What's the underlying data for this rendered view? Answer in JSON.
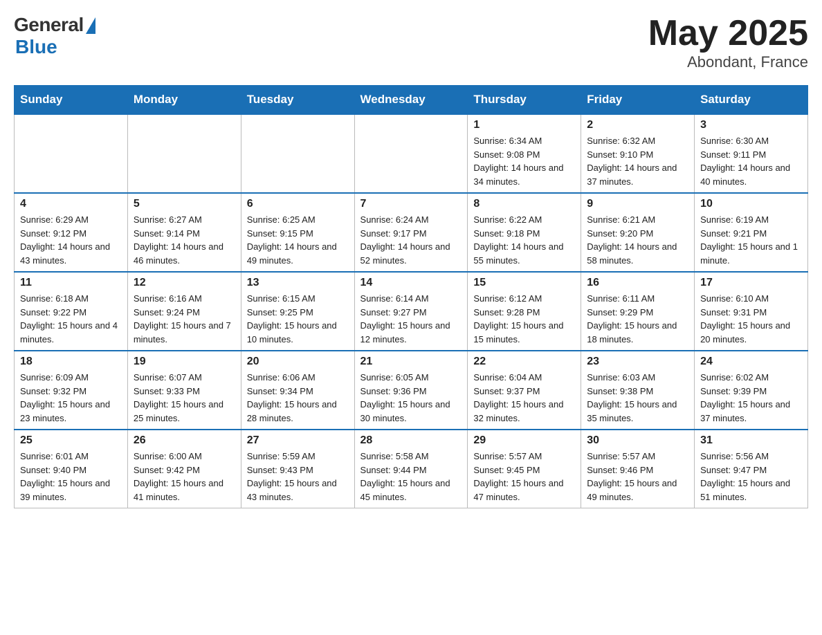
{
  "header": {
    "logo_general": "General",
    "logo_blue": "Blue",
    "month_title": "May 2025",
    "location": "Abondant, France"
  },
  "weekdays": [
    "Sunday",
    "Monday",
    "Tuesday",
    "Wednesday",
    "Thursday",
    "Friday",
    "Saturday"
  ],
  "weeks": [
    [
      {
        "day": "",
        "info": ""
      },
      {
        "day": "",
        "info": ""
      },
      {
        "day": "",
        "info": ""
      },
      {
        "day": "",
        "info": ""
      },
      {
        "day": "1",
        "info": "Sunrise: 6:34 AM\nSunset: 9:08 PM\nDaylight: 14 hours and 34 minutes."
      },
      {
        "day": "2",
        "info": "Sunrise: 6:32 AM\nSunset: 9:10 PM\nDaylight: 14 hours and 37 minutes."
      },
      {
        "day": "3",
        "info": "Sunrise: 6:30 AM\nSunset: 9:11 PM\nDaylight: 14 hours and 40 minutes."
      }
    ],
    [
      {
        "day": "4",
        "info": "Sunrise: 6:29 AM\nSunset: 9:12 PM\nDaylight: 14 hours and 43 minutes."
      },
      {
        "day": "5",
        "info": "Sunrise: 6:27 AM\nSunset: 9:14 PM\nDaylight: 14 hours and 46 minutes."
      },
      {
        "day": "6",
        "info": "Sunrise: 6:25 AM\nSunset: 9:15 PM\nDaylight: 14 hours and 49 minutes."
      },
      {
        "day": "7",
        "info": "Sunrise: 6:24 AM\nSunset: 9:17 PM\nDaylight: 14 hours and 52 minutes."
      },
      {
        "day": "8",
        "info": "Sunrise: 6:22 AM\nSunset: 9:18 PM\nDaylight: 14 hours and 55 minutes."
      },
      {
        "day": "9",
        "info": "Sunrise: 6:21 AM\nSunset: 9:20 PM\nDaylight: 14 hours and 58 minutes."
      },
      {
        "day": "10",
        "info": "Sunrise: 6:19 AM\nSunset: 9:21 PM\nDaylight: 15 hours and 1 minute."
      }
    ],
    [
      {
        "day": "11",
        "info": "Sunrise: 6:18 AM\nSunset: 9:22 PM\nDaylight: 15 hours and 4 minutes."
      },
      {
        "day": "12",
        "info": "Sunrise: 6:16 AM\nSunset: 9:24 PM\nDaylight: 15 hours and 7 minutes."
      },
      {
        "day": "13",
        "info": "Sunrise: 6:15 AM\nSunset: 9:25 PM\nDaylight: 15 hours and 10 minutes."
      },
      {
        "day": "14",
        "info": "Sunrise: 6:14 AM\nSunset: 9:27 PM\nDaylight: 15 hours and 12 minutes."
      },
      {
        "day": "15",
        "info": "Sunrise: 6:12 AM\nSunset: 9:28 PM\nDaylight: 15 hours and 15 minutes."
      },
      {
        "day": "16",
        "info": "Sunrise: 6:11 AM\nSunset: 9:29 PM\nDaylight: 15 hours and 18 minutes."
      },
      {
        "day": "17",
        "info": "Sunrise: 6:10 AM\nSunset: 9:31 PM\nDaylight: 15 hours and 20 minutes."
      }
    ],
    [
      {
        "day": "18",
        "info": "Sunrise: 6:09 AM\nSunset: 9:32 PM\nDaylight: 15 hours and 23 minutes."
      },
      {
        "day": "19",
        "info": "Sunrise: 6:07 AM\nSunset: 9:33 PM\nDaylight: 15 hours and 25 minutes."
      },
      {
        "day": "20",
        "info": "Sunrise: 6:06 AM\nSunset: 9:34 PM\nDaylight: 15 hours and 28 minutes."
      },
      {
        "day": "21",
        "info": "Sunrise: 6:05 AM\nSunset: 9:36 PM\nDaylight: 15 hours and 30 minutes."
      },
      {
        "day": "22",
        "info": "Sunrise: 6:04 AM\nSunset: 9:37 PM\nDaylight: 15 hours and 32 minutes."
      },
      {
        "day": "23",
        "info": "Sunrise: 6:03 AM\nSunset: 9:38 PM\nDaylight: 15 hours and 35 minutes."
      },
      {
        "day": "24",
        "info": "Sunrise: 6:02 AM\nSunset: 9:39 PM\nDaylight: 15 hours and 37 minutes."
      }
    ],
    [
      {
        "day": "25",
        "info": "Sunrise: 6:01 AM\nSunset: 9:40 PM\nDaylight: 15 hours and 39 minutes."
      },
      {
        "day": "26",
        "info": "Sunrise: 6:00 AM\nSunset: 9:42 PM\nDaylight: 15 hours and 41 minutes."
      },
      {
        "day": "27",
        "info": "Sunrise: 5:59 AM\nSunset: 9:43 PM\nDaylight: 15 hours and 43 minutes."
      },
      {
        "day": "28",
        "info": "Sunrise: 5:58 AM\nSunset: 9:44 PM\nDaylight: 15 hours and 45 minutes."
      },
      {
        "day": "29",
        "info": "Sunrise: 5:57 AM\nSunset: 9:45 PM\nDaylight: 15 hours and 47 minutes."
      },
      {
        "day": "30",
        "info": "Sunrise: 5:57 AM\nSunset: 9:46 PM\nDaylight: 15 hours and 49 minutes."
      },
      {
        "day": "31",
        "info": "Sunrise: 5:56 AM\nSunset: 9:47 PM\nDaylight: 15 hours and 51 minutes."
      }
    ]
  ]
}
